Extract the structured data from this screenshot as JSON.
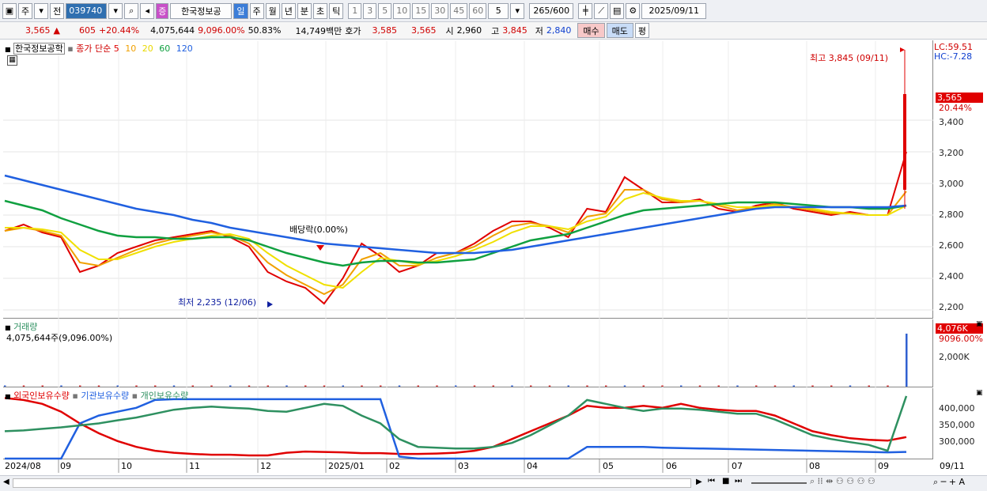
{
  "toolbar": {
    "mode": "주",
    "prev": "전",
    "code": "039740",
    "stock_badge": "증",
    "stock_name": "한국정보공",
    "periods": [
      "일",
      "주",
      "월",
      "년",
      "분",
      "초",
      "틱"
    ],
    "active_period": "일",
    "minutes": [
      "1",
      "3",
      "5",
      "10",
      "15",
      "30",
      "45",
      "60"
    ],
    "custom_value": "5",
    "count": "265",
    "count_max": "/600",
    "date": "2025/09/11"
  },
  "quote": {
    "price": "3,565",
    "arrow": "▲",
    "change": "605",
    "change_pct": "+20.44%",
    "volume": "4,075,644",
    "volume_pct": "9,096.00%",
    "ratio": "50.83%",
    "amount": "14,749백만",
    "ask_label": "호가",
    "ask": "3,585",
    "bid": "3,565",
    "open_label": "시",
    "open": "2,960",
    "high_label": "고",
    "high": "3,845",
    "low_label": "저",
    "low": "2,840",
    "buy": "매수",
    "sell": "매도",
    "avg": "평"
  },
  "legend": {
    "name": "한국정보공학",
    "ma_label": "종가 단순",
    "ma_periods": [
      "5",
      "10",
      "20",
      "60",
      "120"
    ],
    "ma_colors": [
      "#e00000",
      "#f0a000",
      "#f0e000",
      "#10a040",
      "#2060e0"
    ],
    "vol_title": "거래량",
    "vol_text": "4,075,644주(9,096.00%)",
    "flows": [
      "외국인보유수량",
      "기관보유수량",
      "개인보유수량"
    ],
    "flow_colors": [
      "#e00000",
      "#2060e0",
      "#2e9060"
    ]
  },
  "annotations": {
    "high": "최고 3,845 (09/11)",
    "low": "최저 2,235 (12/06)",
    "dividend": "배당락(0.00%)"
  },
  "axis": {
    "lc": "LC:59.51",
    "hc": "HC:-7.28",
    "price_tag": "3,565",
    "pct_tag": "20.44%",
    "vol_tag": "4,076K",
    "vol_pct_tag": "9096.00%",
    "price_ticks": [
      "3,400",
      "3,200",
      "3,000",
      "2,800",
      "2,600",
      "2,400",
      "2,200"
    ],
    "vol_ticks": [
      "2,000K"
    ],
    "flow_ticks": [
      "400,000",
      "350,000",
      "300,000"
    ]
  },
  "xaxis": {
    "labels": [
      "2024/08",
      "09",
      "10",
      "11",
      "12",
      "2025/01",
      "02",
      "03",
      "04",
      "05",
      "06",
      "07",
      "08",
      "09",
      "09/11"
    ]
  },
  "chart_data": [
    {
      "type": "line",
      "title": "",
      "series": [
        {
          "name": "5",
          "values": [
            2700,
            2740,
            2690,
            2660,
            2440,
            2480,
            2560,
            2600,
            2640,
            2660,
            2680,
            2700,
            2660,
            2600,
            2440,
            2380,
            2340,
            2240,
            2400,
            2620,
            2540,
            2440,
            2480,
            2560,
            2560,
            2620,
            2700,
            2760,
            2760,
            2720,
            2660,
            2840,
            2820,
            3040,
            2960,
            2880,
            2880,
            2900,
            2840,
            2820,
            2860,
            2880,
            2840,
            2820,
            2800,
            2820,
            2800,
            2800,
            3200
          ]
        },
        {
          "name": "10",
          "values": [
            2700,
            2720,
            2700,
            2670,
            2500,
            2480,
            2530,
            2580,
            2620,
            2650,
            2670,
            2690,
            2670,
            2620,
            2500,
            2420,
            2360,
            2300,
            2360,
            2520,
            2560,
            2480,
            2480,
            2530,
            2560,
            2600,
            2670,
            2730,
            2750,
            2730,
            2690,
            2790,
            2810,
            2960,
            2960,
            2900,
            2880,
            2890,
            2860,
            2830,
            2850,
            2870,
            2850,
            2830,
            2810,
            2810,
            2800,
            2800,
            2950
          ]
        },
        {
          "name": "20",
          "values": [
            2720,
            2720,
            2710,
            2690,
            2580,
            2520,
            2520,
            2560,
            2600,
            2630,
            2650,
            2670,
            2680,
            2650,
            2560,
            2480,
            2420,
            2360,
            2340,
            2440,
            2530,
            2510,
            2490,
            2510,
            2540,
            2580,
            2630,
            2690,
            2730,
            2730,
            2710,
            2760,
            2790,
            2900,
            2940,
            2910,
            2890,
            2890,
            2870,
            2850,
            2850,
            2860,
            2850,
            2840,
            2820,
            2810,
            2800,
            2800,
            2860
          ]
        },
        {
          "name": "60",
          "values": [
            2890,
            2860,
            2830,
            2780,
            2740,
            2700,
            2670,
            2660,
            2660,
            2650,
            2650,
            2660,
            2660,
            2640,
            2600,
            2560,
            2530,
            2500,
            2480,
            2500,
            2510,
            2510,
            2500,
            2500,
            2510,
            2520,
            2560,
            2600,
            2640,
            2660,
            2680,
            2720,
            2760,
            2800,
            2830,
            2840,
            2850,
            2860,
            2870,
            2880,
            2880,
            2880,
            2870,
            2860,
            2850,
            2850,
            2840,
            2840,
            2860
          ]
        },
        {
          "name": "120",
          "values": [
            3050,
            3020,
            2990,
            2960,
            2930,
            2900,
            2870,
            2840,
            2820,
            2800,
            2770,
            2750,
            2720,
            2700,
            2680,
            2660,
            2640,
            2620,
            2610,
            2600,
            2590,
            2580,
            2570,
            2560,
            2560,
            2560,
            2570,
            2580,
            2600,
            2620,
            2640,
            2660,
            2680,
            2700,
            2720,
            2740,
            2760,
            2780,
            2800,
            2820,
            2840,
            2850,
            2850,
            2850,
            2850,
            2850,
            2850,
            2850,
            2860
          ]
        }
      ],
      "xlabel": "",
      "ylabel": "",
      "ylim": [
        2150,
        3900
      ]
    },
    {
      "type": "bar",
      "title": "",
      "series": [
        {
          "name": "거래량",
          "values": [
            20000,
            18000,
            15000,
            22000,
            30000,
            18000,
            15000,
            12000,
            14000,
            16000,
            15000,
            14000,
            18000,
            25000,
            30000,
            28000,
            32000,
            45000,
            40000,
            60000,
            35000,
            25000,
            20000,
            22000,
            24000,
            26000,
            30000,
            28000,
            26000,
            24000,
            22000,
            35000,
            40000,
            38000,
            30000,
            26000,
            24000,
            22000,
            20000,
            18000,
            18000,
            16000,
            18000,
            16000,
            16000,
            15000,
            18000,
            30000,
            4075644
          ]
        }
      ],
      "ylim": [
        0,
        4500000
      ]
    },
    {
      "type": "line",
      "title": "",
      "series": [
        {
          "name": "외국인보유수량",
          "values": [
            425000,
            420000,
            410000,
            390000,
            360000,
            335000,
            315000,
            300000,
            290000,
            285000,
            282000,
            280000,
            280000,
            278000,
            278000,
            285000,
            288000,
            287000,
            286000,
            284000,
            284000,
            282000,
            282000,
            283000,
            285000,
            290000,
            300000,
            320000,
            340000,
            360000,
            380000,
            405000,
            400000,
            400000,
            405000,
            400000,
            410000,
            400000,
            395000,
            392000,
            392000,
            380000,
            360000,
            340000,
            330000,
            322000,
            318000,
            316000,
            325000
          ]
        },
        {
          "name": "기관보유수량",
          "values": [
            270000,
            270000,
            270000,
            270000,
            360000,
            380000,
            390000,
            400000,
            420000,
            422000,
            422000,
            422000,
            422000,
            422000,
            422000,
            422000,
            422000,
            422000,
            422000,
            422000,
            422000,
            275000,
            270000,
            270000,
            270000,
            270000,
            270000,
            270000,
            270000,
            270000,
            270000,
            300000,
            300000,
            300000,
            300000,
            298000,
            297000,
            296000,
            295000,
            294000,
            293000,
            292000,
            291000,
            290000,
            289000,
            288000,
            287000,
            286000,
            287000
          ]
        },
        {
          "name": "개인보유수량",
          "values": [
            340000,
            342000,
            346000,
            350000,
            355000,
            360000,
            368000,
            375000,
            385000,
            395000,
            400000,
            403000,
            400000,
            398000,
            392000,
            390000,
            400000,
            410000,
            405000,
            380000,
            360000,
            320000,
            300000,
            298000,
            296000,
            296000,
            300000,
            310000,
            330000,
            355000,
            380000,
            420000,
            410000,
            400000,
            392000,
            398000,
            398000,
            395000,
            390000,
            385000,
            385000,
            370000,
            350000,
            330000,
            320000,
            312000,
            305000,
            290000,
            430000
          ]
        }
      ],
      "ylim": [
        270000,
        440000
      ]
    }
  ]
}
